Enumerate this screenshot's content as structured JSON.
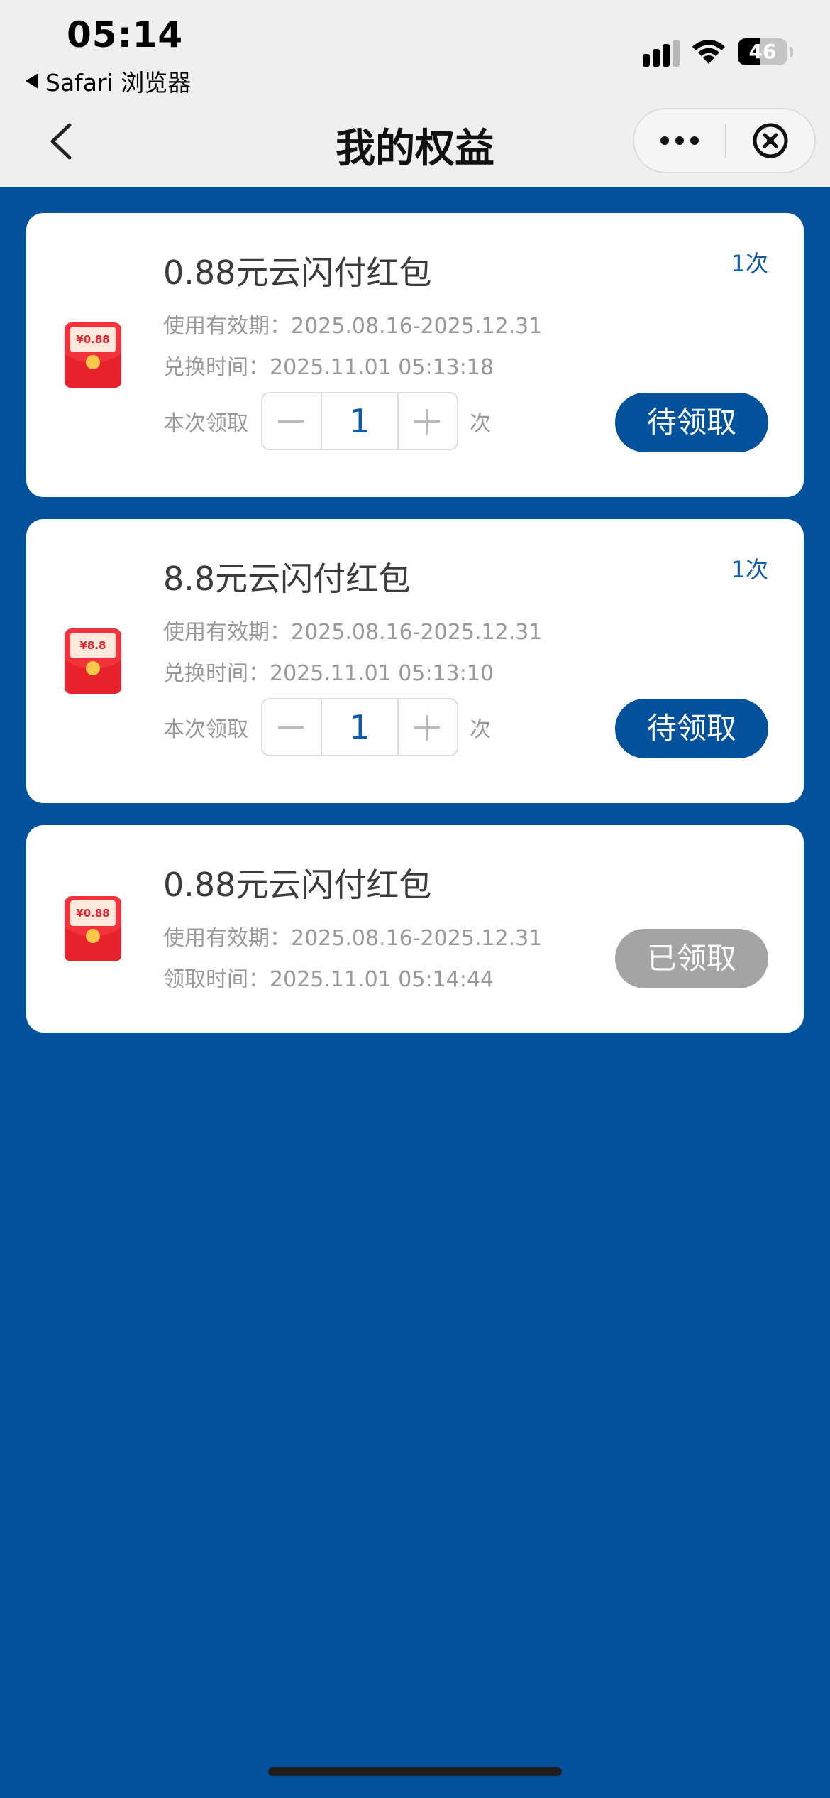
{
  "status_bar": {
    "time": "05:14",
    "back_app": "Safari 浏览器",
    "battery_level": "46"
  },
  "nav": {
    "title": "我的权益"
  },
  "colors": {
    "page_background": "#02519b",
    "primary_button": "#02519b",
    "disabled_button": "#a4a4a4",
    "accent_text": "#0d5aa7",
    "envelope_red": "#f2333b"
  },
  "cards": [
    {
      "envelope_label": "¥0.88",
      "title": "0.88元云闪付红包",
      "count": "1次",
      "validity": "使用有效期：2025.08.16-2025.12.31",
      "time_line": "兑换时间：2025.11.01 05:13:18",
      "qty_label": "本次领取",
      "qty_value": "1",
      "qty_unit": "次",
      "action": "待领取"
    },
    {
      "envelope_label": "¥8.8",
      "title": "8.8元云闪付红包",
      "count": "1次",
      "validity": "使用有效期：2025.08.16-2025.12.31",
      "time_line": "兑换时间：2025.11.01 05:13:10",
      "qty_label": "本次领取",
      "qty_value": "1",
      "qty_unit": "次",
      "action": "待领取"
    },
    {
      "envelope_label": "¥0.88",
      "title": "0.88元云闪付红包",
      "validity": "使用有效期：2025.08.16-2025.12.31",
      "time_line": "领取时间：2025.11.01 05:14:44",
      "action": "已领取"
    }
  ]
}
